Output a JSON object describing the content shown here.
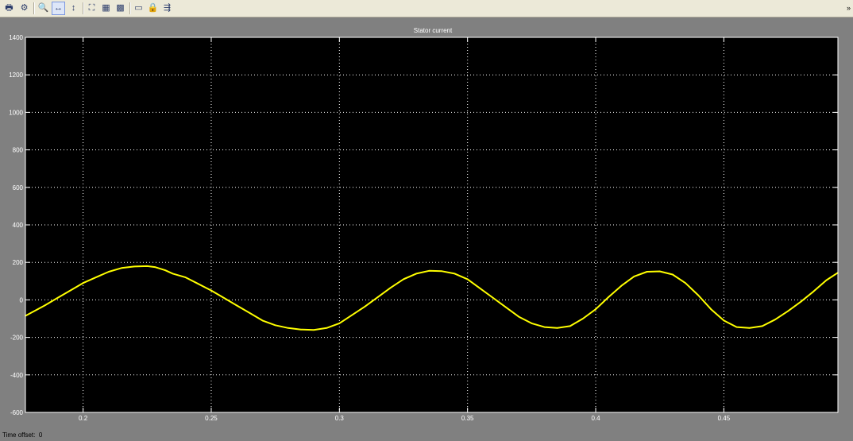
{
  "toolbar": {
    "buttons": [
      {
        "name": "print-button",
        "icon": "printer-icon",
        "glyph": "🖶"
      },
      {
        "name": "parameters-button",
        "icon": "gear-icon",
        "glyph": "⚙"
      },
      {
        "name": "zoom-button",
        "icon": "magnifier-icon",
        "glyph": "🔍"
      },
      {
        "name": "zoom-x-button",
        "icon": "zoom-x-axis-icon",
        "glyph": "↔"
      },
      {
        "name": "zoom-y-button",
        "icon": "zoom-y-axis-icon",
        "glyph": "↕"
      },
      {
        "name": "autoscale-button",
        "icon": "autoscale-icon",
        "glyph": "⛶"
      },
      {
        "name": "save-axes-button",
        "icon": "save-axes-icon",
        "glyph": "▦"
      },
      {
        "name": "restore-axes-button",
        "icon": "restore-axes-icon",
        "glyph": "▩"
      },
      {
        "name": "floating-scope-button",
        "icon": "floating-scope-icon",
        "glyph": "▭"
      },
      {
        "name": "lock-axes-button",
        "icon": "lock-icon",
        "glyph": "🔒"
      },
      {
        "name": "signal-selection-button",
        "icon": "signal-selector-icon",
        "glyph": "⇶"
      }
    ],
    "menu_arrow": "»"
  },
  "footer": {
    "time_offset_label": "Time offset:",
    "time_offset_value": "0"
  },
  "colors": {
    "plot_background": "#000000",
    "frame_background": "#808080",
    "axis_text": "#ffffff",
    "grid": "#ffffff",
    "trace": "#ffff00"
  },
  "chart_data": {
    "type": "line",
    "title": "Stator current",
    "xlabel": "",
    "ylabel": "",
    "xlim": [
      0.1775,
      0.4945
    ],
    "ylim": [
      -600,
      1400
    ],
    "xticks": [
      "0.2",
      "0.25",
      "0.3",
      "0.35",
      "0.4",
      "0.45"
    ],
    "yticks": [
      "1400",
      "1200",
      "1000",
      "800",
      "600",
      "400",
      "200",
      "0",
      "-200",
      "-400",
      "-600"
    ],
    "grid": true,
    "series": [
      {
        "color": "#ffff00",
        "x": [
          0.1775,
          0.185,
          0.19,
          0.195,
          0.2,
          0.205,
          0.21,
          0.215,
          0.22,
          0.225,
          0.228,
          0.232,
          0.235,
          0.24,
          0.245,
          0.25,
          0.255,
          0.26,
          0.265,
          0.27,
          0.275,
          0.28,
          0.285,
          0.29,
          0.295,
          0.3,
          0.305,
          0.31,
          0.315,
          0.32,
          0.325,
          0.33,
          0.335,
          0.34,
          0.345,
          0.35,
          0.355,
          0.36,
          0.365,
          0.37,
          0.375,
          0.38,
          0.385,
          0.39,
          0.395,
          0.4,
          0.405,
          0.41,
          0.415,
          0.42,
          0.425,
          0.43,
          0.435,
          0.44,
          0.445,
          0.45,
          0.455,
          0.46,
          0.465,
          0.47,
          0.475,
          0.48,
          0.485,
          0.49,
          0.4945
        ],
        "y": [
          -85,
          -30,
          10,
          50,
          90,
          120,
          150,
          170,
          178,
          180,
          175,
          158,
          140,
          120,
          85,
          50,
          10,
          -30,
          -70,
          -110,
          -135,
          -150,
          -158,
          -160,
          -150,
          -125,
          -80,
          -35,
          15,
          65,
          110,
          140,
          155,
          153,
          140,
          110,
          60,
          10,
          -40,
          -90,
          -125,
          -145,
          -150,
          -140,
          -100,
          -50,
          15,
          75,
          125,
          150,
          152,
          135,
          90,
          25,
          -50,
          -110,
          -145,
          -150,
          -140,
          -105,
          -60,
          -10,
          45,
          105,
          145
        ]
      }
    ]
  }
}
